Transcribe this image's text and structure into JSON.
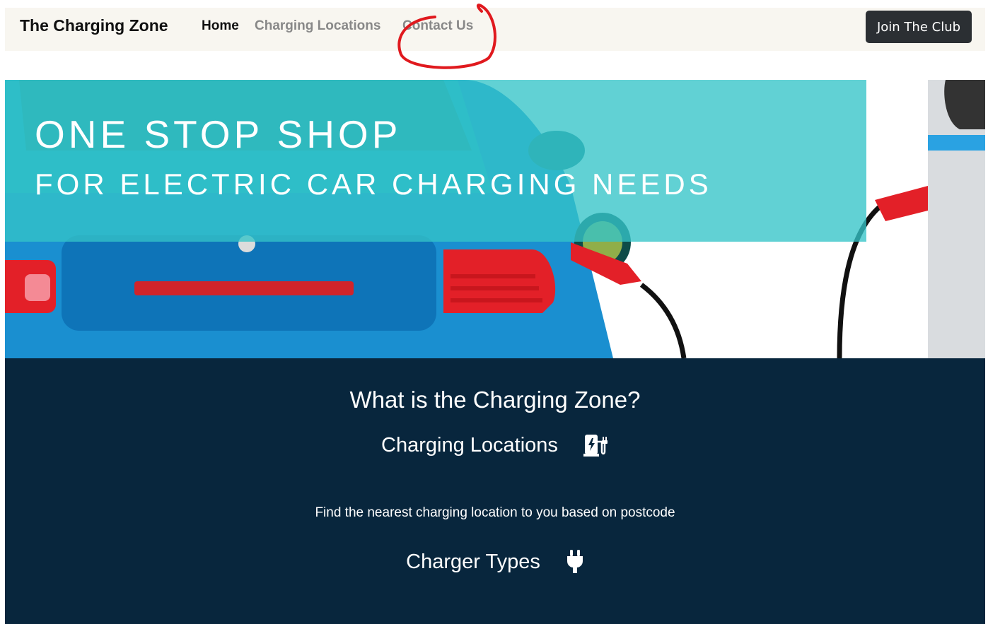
{
  "navbar": {
    "brand": "The Charging Zone",
    "links": [
      {
        "label": "Home",
        "active": true
      },
      {
        "label": "Charging Locations",
        "active": false
      },
      {
        "label": "Contact Us",
        "active": false
      }
    ],
    "cta_label": "Join The Club"
  },
  "hero": {
    "title": "ONE STOP SHOP",
    "subtitle": "FOR ELECTRIC CAR CHARGING NEEDS"
  },
  "info": {
    "heading": "What is the Charging Zone?",
    "features": [
      {
        "title": "Charging Locations",
        "icon": "charging-station-icon",
        "description": "Find the nearest charging location to you based on postcode"
      },
      {
        "title": "Charger Types",
        "icon": "plug-icon",
        "description": ""
      }
    ]
  },
  "colors": {
    "navbar_bg": "#f8f6f0",
    "cta_bg": "#2b2f33",
    "hero_banner": "#34c4c8",
    "info_bg": "#08263d",
    "annotation": "#e0191e"
  }
}
